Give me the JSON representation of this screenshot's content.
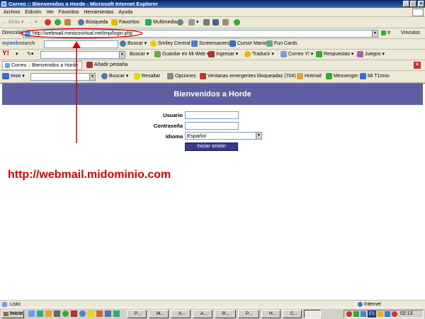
{
  "window": {
    "title": "Correo :: Bienvenidos a Horde - Microsoft Internet Explorer"
  },
  "menu": [
    "Archivo",
    "Edición",
    "Ver",
    "Favoritos",
    "Herramientas",
    "Ayuda"
  ],
  "toolbar": {
    "back": "Atrás",
    "search": "Búsqueda",
    "favorites": "Favoritos",
    "multimedia": "Multimedia"
  },
  "address": {
    "label": "Dirección",
    "url": "http://webmail.mexicovirtual.net/imp/login.php",
    "go": "Ir",
    "links": "Vínculos"
  },
  "mywebsearch": {
    "logo_a": "my",
    "logo_b": "web",
    "logo_c": "search",
    "search_btn": "Buscar",
    "smiley": "Smiley Central",
    "screensavers": "Screensavers",
    "cursor": "Cursor Mania",
    "funcards": "Fun Cards"
  },
  "yahoo": {
    "logo": "Y!",
    "search_btn": "Buscar",
    "save": "Guardar en Mi Web",
    "signin": "Ingresar",
    "translate": "Traducir",
    "mail": "Correo Y!",
    "answers": "Respuestas",
    "games": "Juegos"
  },
  "tabs": {
    "active_tab": "Correo :: Bienvenidos a Horde",
    "add_tab": "Añadir pestaña"
  },
  "msn": {
    "logo": "msn",
    "search_btn": "Buscar",
    "highlight": "Resaltar",
    "options": "Opciones",
    "popups": "Ventanas emergentes bloqueadas (704)",
    "hotmail": "Hotmail",
    "messenger": "Messenger",
    "mymsn": "Mi T1msn"
  },
  "horde": {
    "heading": "Bienvenidos a Horde",
    "user_label": "Usuario",
    "password_label": "Contraseña",
    "language_label": "Idioma",
    "language_value": "Español",
    "login_button": "Iniciar sesión"
  },
  "annotation": {
    "text": "http://webmail.midominio.com",
    "color": "#d40000"
  },
  "status": {
    "text": "Listo",
    "zone": "Internet"
  },
  "taskbar": {
    "start": "Inicio",
    "tasks": [
      "P...",
      "M...",
      "A...",
      "A...",
      "B...",
      "P...",
      "H...",
      "C..."
    ],
    "time": "02:13 p.m.",
    "lang": "ES"
  }
}
